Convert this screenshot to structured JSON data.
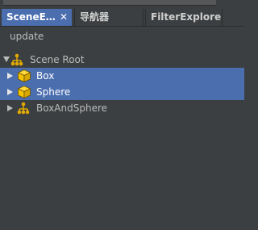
{
  "tabs": [
    {
      "label": "SceneE…",
      "active": true
    },
    {
      "label": "导航器",
      "active": false
    },
    {
      "label": "FilterExplorer",
      "active": false
    }
  ],
  "tab_close_glyph": "✕",
  "toolbar": {
    "update_label": "update"
  },
  "tree": {
    "root": {
      "label": "Scene Root",
      "icon": "node-hierarchy-icon",
      "expanded": true
    },
    "children": [
      {
        "label": "Box",
        "icon": "cube-icon",
        "selected": true,
        "expanded": false
      },
      {
        "label": "Sphere",
        "icon": "cube-icon",
        "selected": true,
        "expanded": false
      },
      {
        "label": "BoxAndSphere",
        "icon": "node-hierarchy-icon",
        "selected": false,
        "expanded": false
      }
    ]
  },
  "colors": {
    "background": "#3c3f41",
    "selection": "#4b6eaf",
    "text": "#bbbbbb",
    "cube": "#f2c200",
    "node": "#e0a800"
  }
}
